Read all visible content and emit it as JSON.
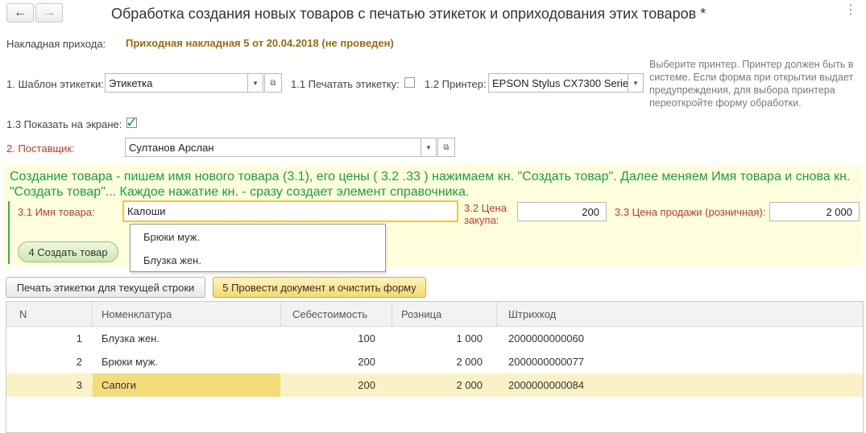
{
  "nav": {
    "back": "←",
    "forward": "→"
  },
  "header": {
    "title": "Обработка создания новых товаров с печатью этикеток и оприходования этих товаров *",
    "more": "⋮"
  },
  "invoice": {
    "label": "Накладная прихода:",
    "value": "Приходная накладная 5 от 20.04.2018 (не проведен)"
  },
  "template": {
    "label": "1. Шаблон этикетки:",
    "value": "Этикетка"
  },
  "print_label": {
    "label": "1.1 Печатать этикетку:",
    "checked": false
  },
  "printer": {
    "label": "1.2 Принтер:",
    "value": "EPSON Stylus CX7300 Serie",
    "hint": "Выберите принтер. Принтер должен быть в системе. Если форма при открытии выдает предупреждения, для выбора принтера переоткройте форму обработки."
  },
  "show_on_screen": {
    "label": "1.3 Показать на экране:",
    "checked": true
  },
  "supplier": {
    "label": "2. Поставщик:",
    "value": "Султанов Арслан"
  },
  "create_section": {
    "instructions": "Создание товара -  пишем имя нового товара (3.1), его цены ( 3.2 .33 ) нажимаем кн. \"Создать товар\". Далее меняем Имя товара и снова кн. \"Создать товар\"...  Каждое нажатие кн. - сразу создает элемент справочника.",
    "name_label": "3.1 Имя товара:",
    "name_value": "Калоши",
    "cost_label_line1": "3.2 Цена",
    "cost_label_line2": "закупа:",
    "cost_value": "200",
    "retail_label": "3.3 Цена продажи (розничная):",
    "retail_value": "2 000",
    "create_button": "4 Создать товар",
    "suggestions": [
      "Брюки муж.",
      "Блузка жен."
    ]
  },
  "actions": {
    "print_labels": "Печать этикетки для текущей строки",
    "post_clear": "5 Провести документ и очистить форму"
  },
  "table": {
    "columns": [
      "N",
      "Номенклатура",
      "Себестоимость",
      "Розница",
      "Штрихкод"
    ],
    "rows": [
      {
        "n": "1",
        "name": "Блузка жен.",
        "cost": "100",
        "retail": "1 000",
        "barcode": "2000000000060"
      },
      {
        "n": "2",
        "name": "Брюки муж.",
        "cost": "200",
        "retail": "2 000",
        "barcode": "2000000000077"
      },
      {
        "n": "3",
        "name": "Сапоги",
        "cost": "200",
        "retail": "2 000",
        "barcode": "2000000000084"
      }
    ],
    "selected_row": 3
  }
}
